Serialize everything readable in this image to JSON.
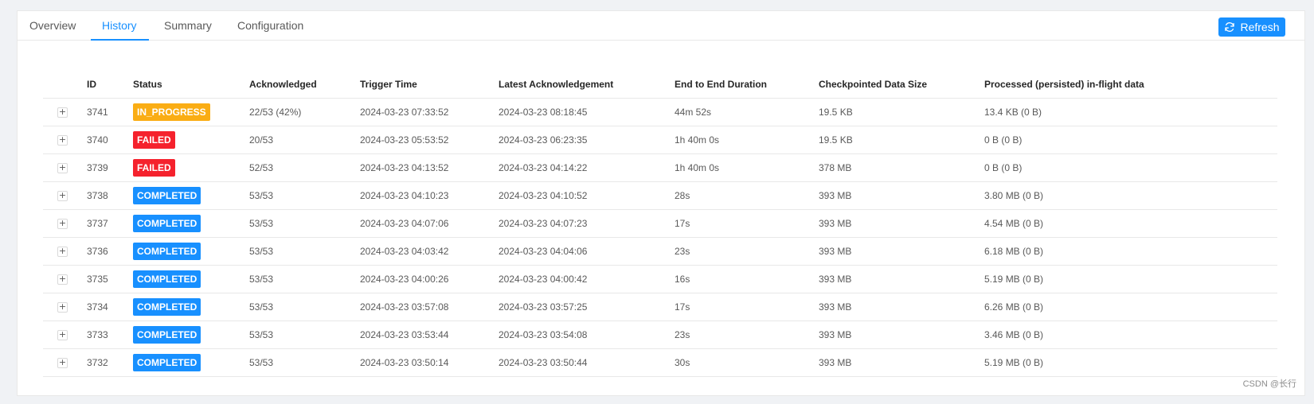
{
  "tabs": [
    {
      "label": "Overview"
    },
    {
      "label": "History"
    },
    {
      "label": "Summary"
    },
    {
      "label": "Configuration"
    }
  ],
  "active_tab": "History",
  "refresh_label": "Refresh",
  "colors": {
    "accent": "#1890ff",
    "in_progress": "#faad14",
    "failed": "#f5222d",
    "completed": "#1890ff"
  },
  "table": {
    "columns": [
      "ID",
      "Status",
      "Acknowledged",
      "Trigger Time",
      "Latest Acknowledgement",
      "End to End Duration",
      "Checkpointed Data Size",
      "Processed (persisted) in-flight data"
    ],
    "expander_symbol": "+",
    "rows": [
      {
        "id": "3741",
        "status": "IN_PROGRESS",
        "status_kind": "in_progress",
        "acknowledged": "22/53 (42%)",
        "trigger_time": "2024-03-23 07:33:52",
        "latest_ack": "2024-03-23 08:18:45",
        "duration": "44m 52s",
        "data_size": "19.5 KB",
        "inflight": "13.4 KB (0 B)"
      },
      {
        "id": "3740",
        "status": "FAILED",
        "status_kind": "failed",
        "acknowledged": "20/53",
        "trigger_time": "2024-03-23 05:53:52",
        "latest_ack": "2024-03-23 06:23:35",
        "duration": "1h 40m 0s",
        "data_size": "19.5 KB",
        "inflight": "0 B (0 B)"
      },
      {
        "id": "3739",
        "status": "FAILED",
        "status_kind": "failed",
        "acknowledged": "52/53",
        "trigger_time": "2024-03-23 04:13:52",
        "latest_ack": "2024-03-23 04:14:22",
        "duration": "1h 40m 0s",
        "data_size": "378 MB",
        "inflight": "0 B (0 B)"
      },
      {
        "id": "3738",
        "status": "COMPLETED",
        "status_kind": "completed",
        "acknowledged": "53/53",
        "trigger_time": "2024-03-23 04:10:23",
        "latest_ack": "2024-03-23 04:10:52",
        "duration": "28s",
        "data_size": "393 MB",
        "inflight": "3.80 MB (0 B)"
      },
      {
        "id": "3737",
        "status": "COMPLETED",
        "status_kind": "completed",
        "acknowledged": "53/53",
        "trigger_time": "2024-03-23 04:07:06",
        "latest_ack": "2024-03-23 04:07:23",
        "duration": "17s",
        "data_size": "393 MB",
        "inflight": "4.54 MB (0 B)"
      },
      {
        "id": "3736",
        "status": "COMPLETED",
        "status_kind": "completed",
        "acknowledged": "53/53",
        "trigger_time": "2024-03-23 04:03:42",
        "latest_ack": "2024-03-23 04:04:06",
        "duration": "23s",
        "data_size": "393 MB",
        "inflight": "6.18 MB (0 B)"
      },
      {
        "id": "3735",
        "status": "COMPLETED",
        "status_kind": "completed",
        "acknowledged": "53/53",
        "trigger_time": "2024-03-23 04:00:26",
        "latest_ack": "2024-03-23 04:00:42",
        "duration": "16s",
        "data_size": "393 MB",
        "inflight": "5.19 MB (0 B)"
      },
      {
        "id": "3734",
        "status": "COMPLETED",
        "status_kind": "completed",
        "acknowledged": "53/53",
        "trigger_time": "2024-03-23 03:57:08",
        "latest_ack": "2024-03-23 03:57:25",
        "duration": "17s",
        "data_size": "393 MB",
        "inflight": "6.26 MB (0 B)"
      },
      {
        "id": "3733",
        "status": "COMPLETED",
        "status_kind": "completed",
        "acknowledged": "53/53",
        "trigger_time": "2024-03-23 03:53:44",
        "latest_ack": "2024-03-23 03:54:08",
        "duration": "23s",
        "data_size": "393 MB",
        "inflight": "3.46 MB (0 B)"
      },
      {
        "id": "3732",
        "status": "COMPLETED",
        "status_kind": "completed",
        "acknowledged": "53/53",
        "trigger_time": "2024-03-23 03:50:14",
        "latest_ack": "2024-03-23 03:50:44",
        "duration": "30s",
        "data_size": "393 MB",
        "inflight": "5.19 MB (0 B)"
      }
    ]
  },
  "watermark": "CSDN @长行"
}
